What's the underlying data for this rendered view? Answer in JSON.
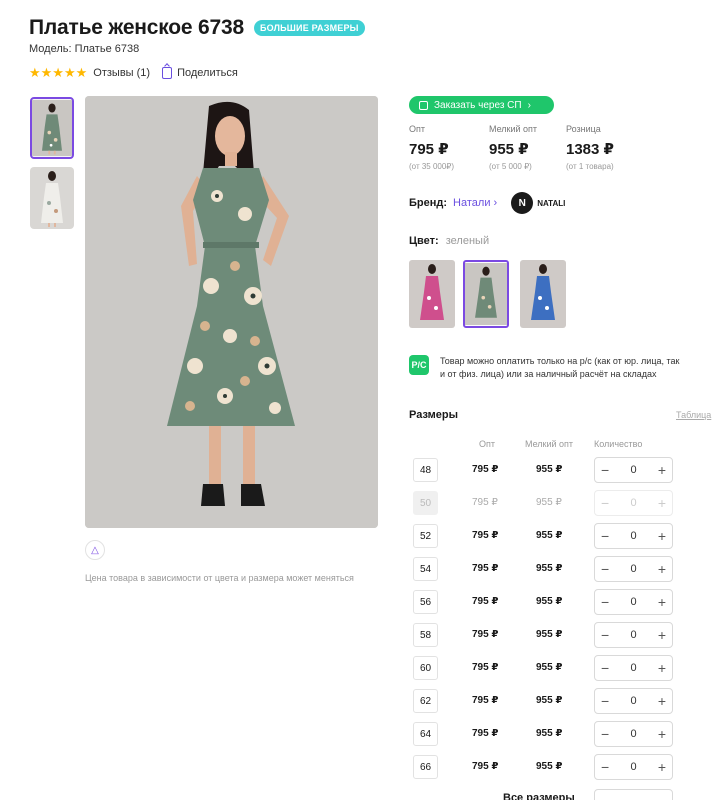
{
  "product": {
    "title": "Платье женское 6738",
    "badge": "БОЛЬШИЕ РАЗМЕРЫ",
    "model": "Модель: Платье 6738",
    "stars": "★★★★★",
    "reviews": "Отзывы (1)",
    "share": "Поделиться",
    "price_note": "Цена товара в зависимости от цвета и размера может меняться"
  },
  "order_button": "Заказать через СП",
  "prices": [
    {
      "label": "Опт",
      "value": "795 ₽",
      "sub": "(от 35 000₽)"
    },
    {
      "label": "Мелкий опт",
      "value": "955 ₽",
      "sub": "(от 5 000 ₽)"
    },
    {
      "label": "Розница",
      "value": "1383 ₽",
      "sub": "(от 1 товара)"
    }
  ],
  "brand": {
    "label": "Бренд:",
    "link": "Натали",
    "logo_letter": "N",
    "logo_text": "NATALI"
  },
  "color": {
    "label": "Цвет:",
    "value": "зеленый"
  },
  "payment": {
    "icon": "Р/С",
    "text": "Товар можно оплатить только на р/с (как от юр. лица, так и от физ. лица) или за наличный расчёт на складах"
  },
  "sizes": {
    "title": "Размеры",
    "table_link": "Таблица",
    "headers": {
      "opt": "Опт",
      "small": "Мелкий опт",
      "qty": "Количество"
    },
    "rows": [
      {
        "size": "48",
        "opt": "795 ₽",
        "small": "955 ₽",
        "qty": "0"
      },
      {
        "size": "50",
        "opt": "795 ₽",
        "small": "955 ₽",
        "qty": "0"
      },
      {
        "size": "52",
        "opt": "795 ₽",
        "small": "955 ₽",
        "qty": "0"
      },
      {
        "size": "54",
        "opt": "795 ₽",
        "small": "955 ₽",
        "qty": "0"
      },
      {
        "size": "56",
        "opt": "795 ₽",
        "small": "955 ₽",
        "qty": "0"
      },
      {
        "size": "58",
        "opt": "795 ₽",
        "small": "955 ₽",
        "qty": "0"
      },
      {
        "size": "60",
        "opt": "795 ₽",
        "small": "955 ₽",
        "qty": "0"
      },
      {
        "size": "62",
        "opt": "795 ₽",
        "small": "955 ₽",
        "qty": "0"
      },
      {
        "size": "64",
        "opt": "795 ₽",
        "small": "955 ₽",
        "qty": "0"
      },
      {
        "size": "66",
        "opt": "795 ₽",
        "small": "955 ₽",
        "qty": "0"
      }
    ],
    "all_sizes": "Все размеры"
  },
  "colors": {
    "accent": "#7b4ae2",
    "green": "#1fc66b",
    "badge": "#3fd0d4",
    "star": "#ffb800"
  }
}
